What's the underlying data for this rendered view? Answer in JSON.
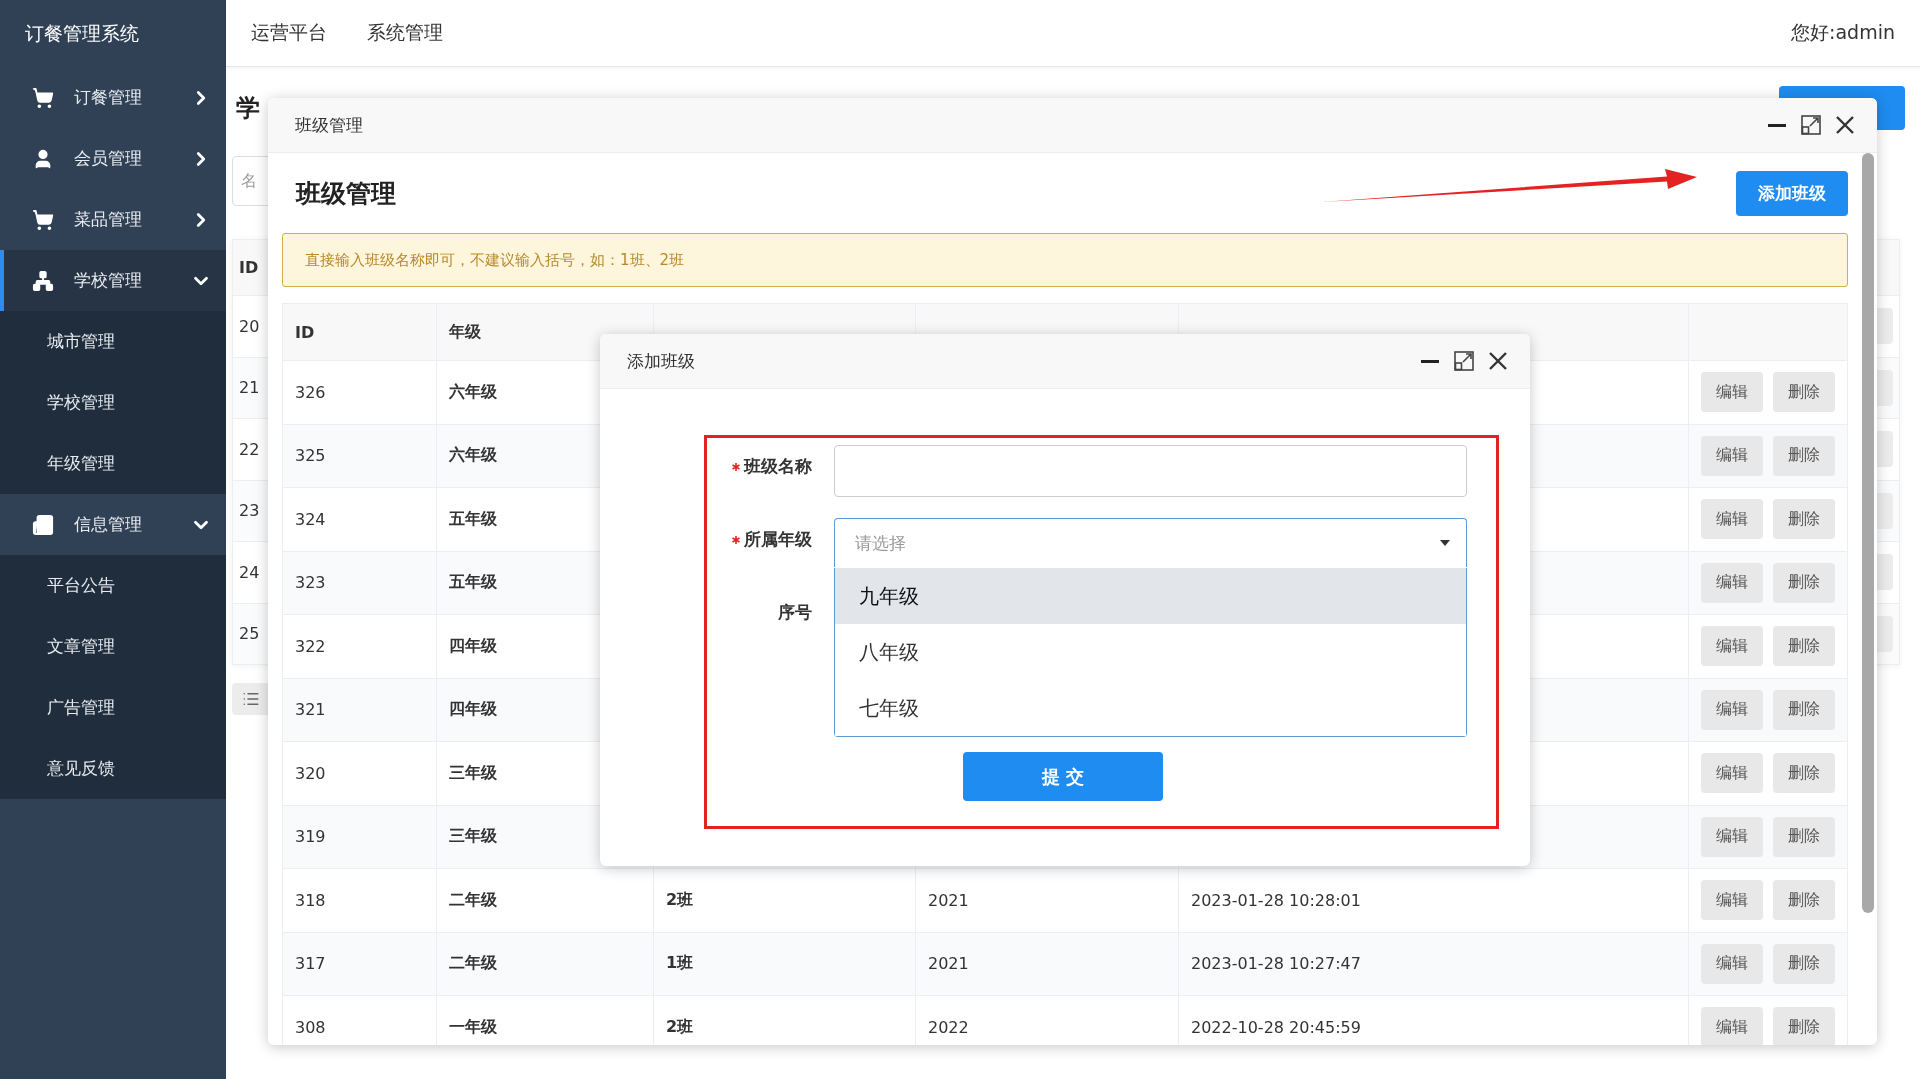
{
  "sidebar": {
    "title": "订餐管理系统",
    "items": [
      {
        "label": "订餐管理",
        "selected": false,
        "expanded": false
      },
      {
        "label": "会员管理",
        "selected": false,
        "expanded": false
      },
      {
        "label": "菜品管理",
        "selected": false,
        "expanded": false
      },
      {
        "label": "学校管理",
        "selected": true,
        "expanded": true,
        "children": [
          {
            "label": "城市管理"
          },
          {
            "label": "学校管理"
          },
          {
            "label": "年级管理"
          }
        ]
      },
      {
        "label": "信息管理",
        "selected": false,
        "expanded": true,
        "children": [
          {
            "label": "平台公告"
          },
          {
            "label": "文章管理"
          },
          {
            "label": "广告管理"
          },
          {
            "label": "意见反馈"
          }
        ]
      }
    ]
  },
  "topnav": {
    "links": [
      "运营平台",
      "系统管理"
    ],
    "greeting": "您好:admin"
  },
  "background_page": {
    "title": "学",
    "search_placeholder": "名",
    "id_header": "ID",
    "row_ids": [
      "20",
      "21",
      "22",
      "23",
      "24",
      "25"
    ]
  },
  "class_dialog": {
    "title": "班级管理",
    "heading": "班级管理",
    "add_button": "添加班级",
    "notice": "直接输入班级名称即可，不建议输入括号，如：1班、2班",
    "columns": [
      "ID",
      "年级"
    ],
    "rows": [
      {
        "id": "326",
        "grade": "六年级",
        "actions": [
          "编辑",
          "删除"
        ]
      },
      {
        "id": "325",
        "grade": "六年级",
        "actions": [
          "编辑",
          "删除"
        ]
      },
      {
        "id": "324",
        "grade": "五年级",
        "actions": [
          "编辑",
          "删除"
        ]
      },
      {
        "id": "323",
        "grade": "五年级",
        "actions": [
          "编辑",
          "删除"
        ]
      },
      {
        "id": "322",
        "grade": "四年级",
        "actions": [
          "编辑",
          "删除"
        ]
      },
      {
        "id": "321",
        "grade": "四年级",
        "actions": [
          "编辑",
          "删除"
        ]
      },
      {
        "id": "320",
        "grade": "三年级",
        "actions": [
          "编辑",
          "删除"
        ]
      },
      {
        "id": "319",
        "grade": "三年级",
        "actions": [
          "编辑",
          "删除"
        ]
      },
      {
        "id": "318",
        "grade": "二年级",
        "class_name": "2班",
        "year": "2021",
        "added": "2023-01-28 10:28:01",
        "actions": [
          "编辑",
          "删除"
        ]
      },
      {
        "id": "317",
        "grade": "二年级",
        "class_name": "1班",
        "year": "2021",
        "added": "2023-01-28 10:27:47",
        "actions": [
          "编辑",
          "删除"
        ]
      },
      {
        "id": "308",
        "grade": "一年级",
        "class_name": "2班",
        "year": "2022",
        "added": "2022-10-28 20:45:59",
        "actions": [
          "编辑",
          "删除"
        ]
      }
    ]
  },
  "add_dialog": {
    "title": "添加班级",
    "fields": [
      {
        "kind": "text",
        "label": "班级名称",
        "required": true
      },
      {
        "kind": "select",
        "label": "所属年级",
        "required": true,
        "placeholder": "请选择",
        "open": true,
        "options": [
          {
            "label": "九年级",
            "highlighted": true
          },
          {
            "label": "八年级",
            "highlighted": false
          },
          {
            "label": "七年级",
            "highlighted": false
          }
        ]
      },
      {
        "kind": "text",
        "label": "序号",
        "required": false
      }
    ],
    "submit": "提 交"
  }
}
